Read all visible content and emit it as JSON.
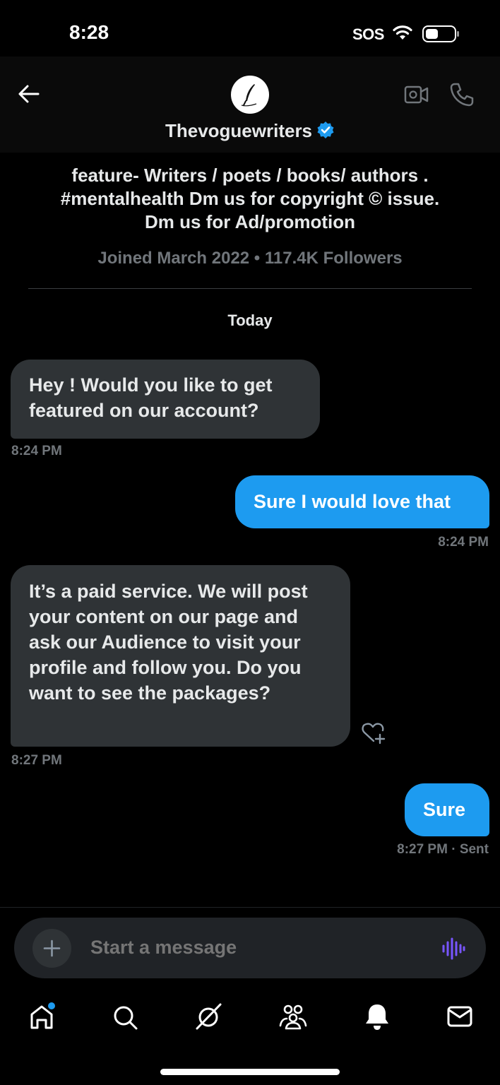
{
  "status_bar": {
    "time": "8:28",
    "sos": "SOS"
  },
  "header": {
    "name": "Thevoguewriters"
  },
  "profile": {
    "bio_lines": [
      "feature- Writers / poets / books/ authors .",
      "#mentalhealth Dm us for copyright © issue.",
      "Dm us for Ad/promotion"
    ],
    "joined": "Joined March 2022 • 117.4K Followers"
  },
  "conversation": {
    "date_label": "Today",
    "messages": [
      {
        "direction": "received",
        "text": "Hey !  Would you like to get featured on our account?",
        "time": "8:24 PM"
      },
      {
        "direction": "sent",
        "text": "Sure I would love that",
        "time": "8:24 PM"
      },
      {
        "direction": "received",
        "text": "It’s a paid service. We will post your content on our page and ask our Audience to visit your profile and follow you. Do you want to see the packages?",
        "time": "8:27 PM"
      },
      {
        "direction": "sent",
        "text": "Sure",
        "time": "8:27 PM · Sent"
      }
    ]
  },
  "composer": {
    "placeholder": "Start a message"
  },
  "icons": [
    "back-arrow-icon",
    "avatar-quill-icon",
    "verified-icon",
    "video-call-icon",
    "phone-icon",
    "heart-plus-icon",
    "plus-icon",
    "voice-icon",
    "home-icon",
    "search-icon",
    "grok-icon",
    "communities-icon",
    "notifications-icon",
    "messages-icon"
  ],
  "colors": {
    "accent": "#1d9bf0",
    "received_bubble": "#2f3336",
    "muted": "#71767b",
    "voice": "#7856ff"
  }
}
